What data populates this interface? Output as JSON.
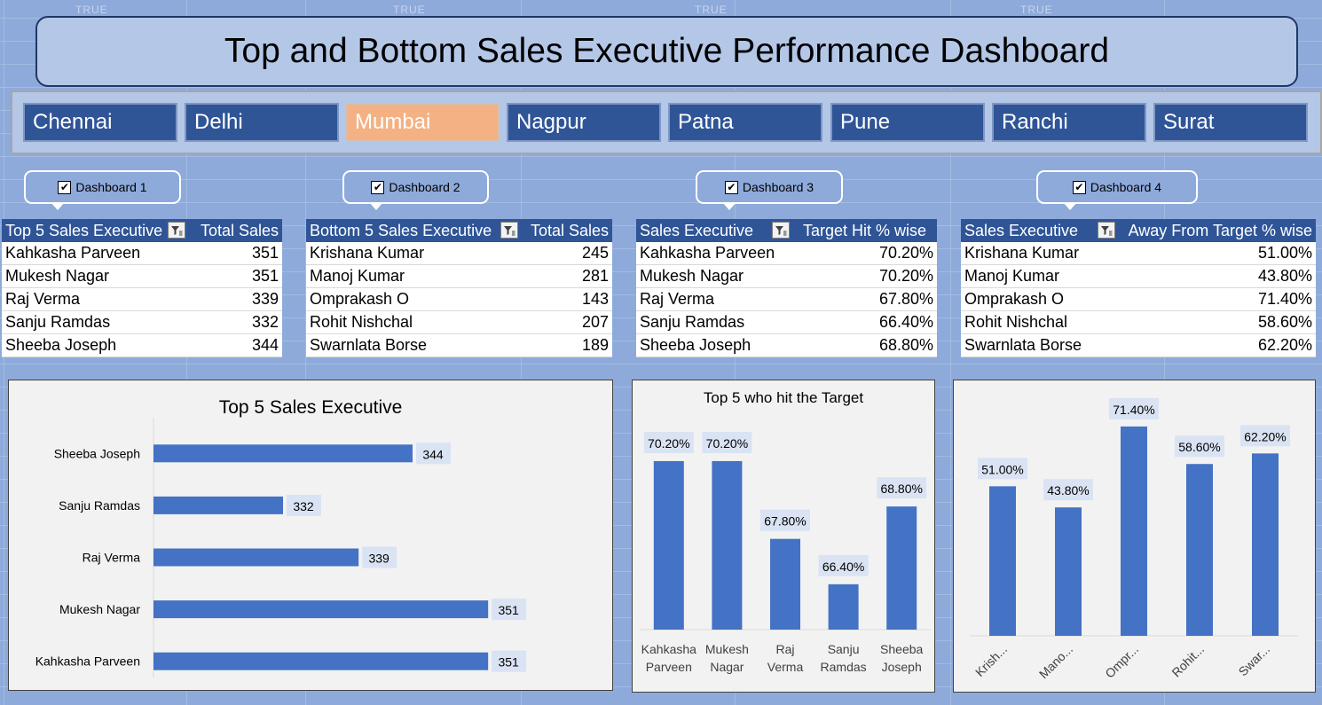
{
  "title": "Top and Bottom Sales Executive Performance Dashboard",
  "grid_tags": [
    "TRUE",
    "TRUE",
    "TRUE",
    "TRUE"
  ],
  "cities": [
    "Chennai",
    "Delhi",
    "Mumbai",
    "Nagpur",
    "Patna",
    "Pune",
    "Ranchi",
    "Surat"
  ],
  "selected_city": "Mumbai",
  "callouts": [
    "Dashboard 1",
    "Dashboard 2",
    "Dashboard 3",
    "Dashboard 4"
  ],
  "checkbox_glyph": "✔",
  "tables": [
    {
      "col1": "Top 5 Sales Executive",
      "col2": "Total Sales",
      "rows": [
        [
          "Kahkasha Parveen",
          "351"
        ],
        [
          "Mukesh Nagar",
          "351"
        ],
        [
          "Raj Verma",
          "339"
        ],
        [
          "Sanju Ramdas",
          "332"
        ],
        [
          "Sheeba Joseph",
          "344"
        ]
      ]
    },
    {
      "col1": "Bottom 5 Sales Executive",
      "col2": "Total Sales",
      "rows": [
        [
          "Krishana Kumar",
          "245"
        ],
        [
          "Manoj Kumar",
          "281"
        ],
        [
          "Omprakash O",
          "143"
        ],
        [
          "Rohit Nishchal",
          "207"
        ],
        [
          "Swarnlata Borse",
          "189"
        ]
      ]
    },
    {
      "col1": "Sales Executive",
      "col2": "Target Hit % wise",
      "rows": [
        [
          "Kahkasha Parveen",
          "70.20%"
        ],
        [
          "Mukesh Nagar",
          "70.20%"
        ],
        [
          "Raj Verma",
          "67.80%"
        ],
        [
          "Sanju Ramdas",
          "66.40%"
        ],
        [
          "Sheeba Joseph",
          "68.80%"
        ]
      ]
    },
    {
      "col1": "Sales Executive",
      "col2": "Away From Target % wise",
      "rows": [
        [
          "Krishana Kumar",
          "51.00%"
        ],
        [
          "Manoj Kumar",
          "43.80%"
        ],
        [
          "Omprakash O",
          "71.40%"
        ],
        [
          "Rohit Nishchal",
          "58.60%"
        ],
        [
          "Swarnlata Borse",
          "62.20%"
        ]
      ]
    }
  ],
  "colors": {
    "bar": "#4472c4",
    "header": "#2f5597",
    "selected": "#f4b183",
    "background": "#8eaadb"
  },
  "chart_data": [
    {
      "type": "bar",
      "orientation": "horizontal",
      "title": "Top 5 Sales Executive",
      "categories": [
        "Sheeba Joseph",
        "Sanju Ramdas",
        "Raj Verma",
        "Mukesh Nagar",
        "Kahkasha Parveen"
      ],
      "values": [
        344,
        332,
        339,
        351,
        351
      ],
      "data_labels": [
        "344",
        "332",
        "339",
        "351",
        "351"
      ],
      "xlim": [
        320,
        356
      ],
      "grid": false
    },
    {
      "type": "bar",
      "title": "Top 5 who hit the Target",
      "categories": [
        [
          "Kahkasha",
          "Parveen"
        ],
        [
          "Mukesh",
          "Nagar"
        ],
        [
          "Raj",
          "Verma"
        ],
        [
          "Sanju",
          "Ramdas"
        ],
        [
          "Sheeba",
          "Joseph"
        ]
      ],
      "values": [
        70.2,
        70.2,
        67.8,
        66.4,
        68.8
      ],
      "data_labels": [
        "70.20%",
        "70.20%",
        "67.80%",
        "66.40%",
        "68.80%"
      ],
      "ylim": [
        65.0,
        70.5
      ],
      "grid": false
    },
    {
      "type": "bar",
      "title": "",
      "categories": [
        "Krish...",
        "Mano...",
        "Ompr...",
        "Rohit...",
        "Swar..."
      ],
      "values": [
        51.0,
        43.8,
        71.4,
        58.6,
        62.2
      ],
      "data_labels": [
        "51.00%",
        "43.80%",
        "71.40%",
        "58.60%",
        "62.20%"
      ],
      "ylim": [
        0,
        75
      ],
      "grid": false
    }
  ]
}
